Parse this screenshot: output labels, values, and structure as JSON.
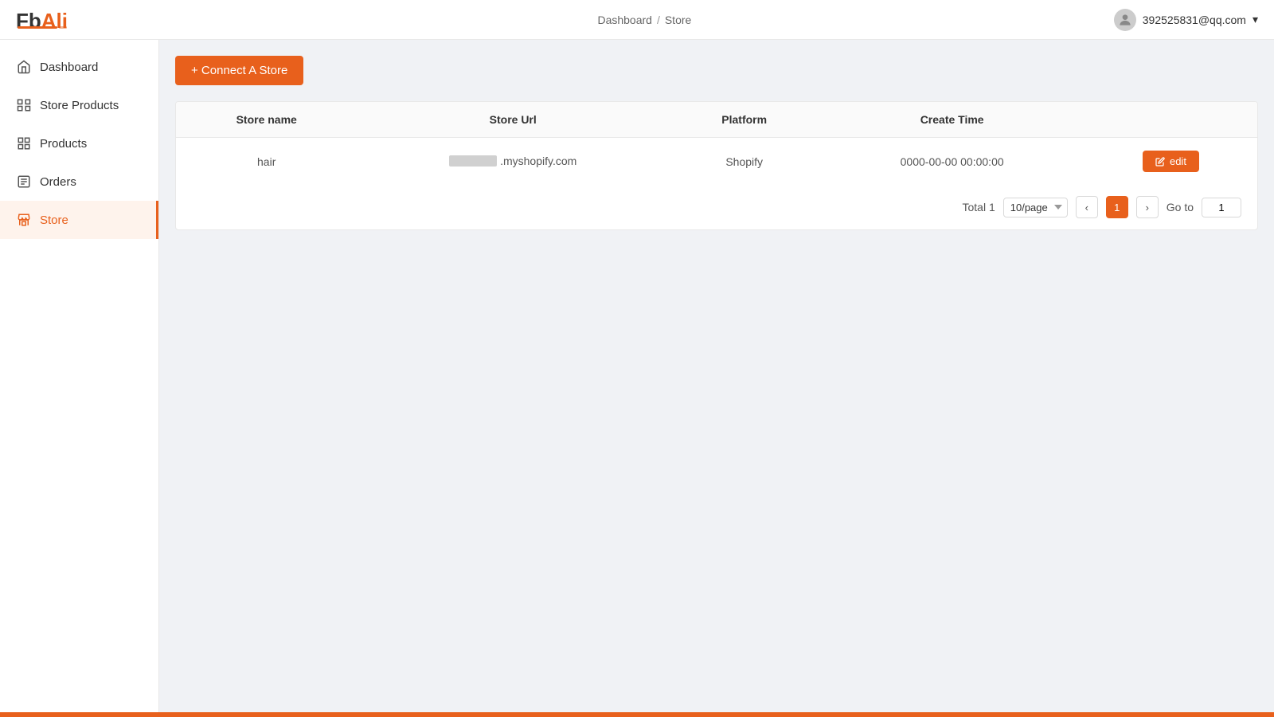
{
  "header": {
    "logo_fb": "Fb",
    "logo_ali": "Ali",
    "breadcrumb_home": "Dashboard",
    "breadcrumb_separator": "/",
    "breadcrumb_current": "Store",
    "user_email": "392525831@qq.com",
    "user_chevron": "▾"
  },
  "sidebar": {
    "items": [
      {
        "id": "dashboard",
        "label": "Dashboard",
        "icon": "home"
      },
      {
        "id": "store-products",
        "label": "Store Products",
        "icon": "tag"
      },
      {
        "id": "products",
        "label": "Products",
        "icon": "grid"
      },
      {
        "id": "orders",
        "label": "Orders",
        "icon": "file"
      },
      {
        "id": "store",
        "label": "Store",
        "icon": "store",
        "active": true
      }
    ]
  },
  "main": {
    "connect_button_label": "+ Connect A Store",
    "table": {
      "columns": [
        "Store name",
        "Store Url",
        "Platform",
        "Create Time"
      ],
      "rows": [
        {
          "store_name": "hair",
          "store_url_prefix": "",
          "store_url_suffix": ".myshopify.com",
          "platform": "Shopify",
          "create_time": "0000-00-00 00:00:00",
          "edit_label": "edit"
        }
      ]
    },
    "pagination": {
      "total_label": "Total 1",
      "page_size": "10/page",
      "current_page": "1",
      "goto_label": "Go to",
      "goto_value": "1"
    }
  }
}
